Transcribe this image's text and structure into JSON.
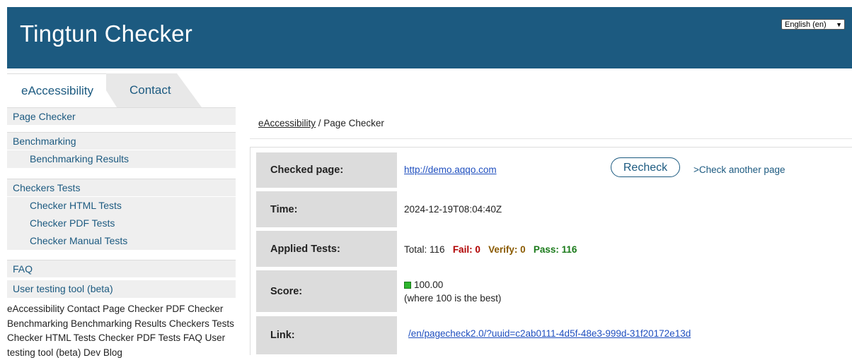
{
  "header": {
    "title": "Tingtun Checker",
    "language": "English (en)"
  },
  "tabs": [
    {
      "label": "eAccessibility"
    },
    {
      "label": "Contact"
    }
  ],
  "sidebar": {
    "items": [
      {
        "label": "Page Checker"
      },
      {
        "label": "Benchmarking"
      },
      {
        "label": "Benchmarking Results"
      },
      {
        "label": "Checkers Tests"
      },
      {
        "label": "Checker HTML Tests"
      },
      {
        "label": "Checker PDF Tests"
      },
      {
        "label": "Checker Manual Tests"
      },
      {
        "label": "FAQ"
      },
      {
        "label": "User testing tool (beta)"
      }
    ],
    "footer_text": "eAccessibility Contact Page Checker PDF Checker Benchmarking Benchmarking Results Checkers Tests Checker HTML Tests Checker PDF Tests FAQ User testing tool (beta) Dev Blog"
  },
  "breadcrumb": {
    "root": "eAccessibility",
    "separator": " / ",
    "current": "Page Checker"
  },
  "result": {
    "checked_page_label": "Checked page:",
    "checked_page_url": "http://demo.aqqo.com",
    "recheck_label": "Recheck",
    "check_another_label": ">Check another page",
    "time_label": "Time:",
    "time_value": "2024-12-19T08:04:40Z",
    "applied_tests_label": "Applied Tests:",
    "total_text": "Total: 116",
    "fail_text": "Fail: 0",
    "verify_text": "Verify: 0",
    "pass_text": "Pass: 116",
    "score_label": "Score:",
    "score_value": "100.00",
    "score_note": "(where 100 is the best)",
    "link_label": "Link:",
    "link_value": "/en/pagecheck2.0/?uuid=c2ab0111-4d5f-48e3-999d-31f20172e13d"
  },
  "colors": {
    "header_bg": "#1c5a80",
    "score_indicator": "#2db52d"
  }
}
